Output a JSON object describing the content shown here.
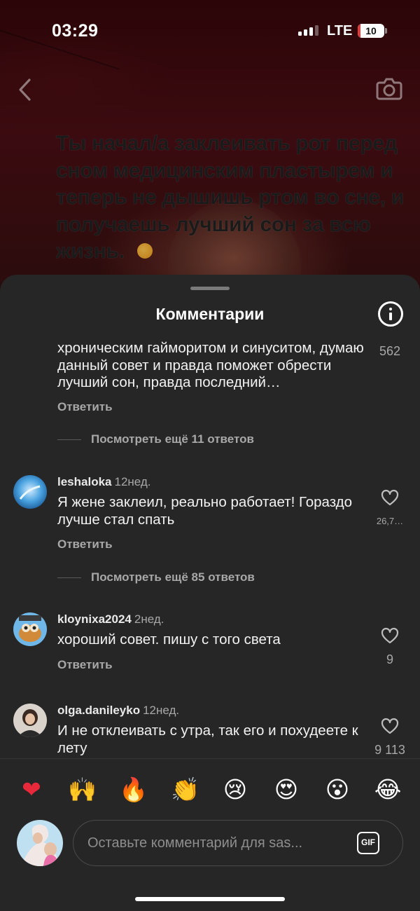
{
  "status_bar": {
    "time": "03:29",
    "network": "LTE",
    "battery": "10",
    "battery_level": 0.1,
    "battery_color": "#e23b3b"
  },
  "caption": {
    "text": "Ты начал/а заклеивать рот перед сном медицинским пластырем и теперь не дышишь ртом во сне, и получаешь лучший сон за всю жизнь."
  },
  "sheet": {
    "title": "Комментарии"
  },
  "comments": [
    {
      "text": "хроническим гайморитом и синуситом, думаю данный совет и правда поможет обрести лучший сон, правда последний…",
      "likes": "562",
      "reply_label": "Ответить",
      "more_replies": "Посмотреть ещё 11 ответов"
    },
    {
      "username": "leshaloka",
      "time": "12нед.",
      "text": "Я жене заклеил, реально работает! Гораздо лучше стал спать",
      "likes": "26,7…",
      "reply_label": "Ответить",
      "more_replies": "Посмотреть ещё 85 ответов"
    },
    {
      "username": "kloynixa2024",
      "time": "2нед.",
      "text": "хороший совет. пишу с того света",
      "likes": "9",
      "reply_label": "Ответить"
    },
    {
      "username": "olga.danileyko",
      "time": "12нед.",
      "text": "И не отклеивать с утра, так его и похудеете к лету",
      "likes": "9 113"
    }
  ],
  "emoji_bar": [
    "❤",
    "🙌",
    "🔥",
    "👏",
    "😢",
    "😍",
    "😮",
    "😂"
  ],
  "input": {
    "placeholder": "Оставьте комментарий для sas...",
    "gif_label": "GIF"
  },
  "icons": {
    "back": "chevron-left-icon",
    "camera": "camera-icon",
    "info": "info-icon",
    "heart": "heart-outline-icon"
  }
}
